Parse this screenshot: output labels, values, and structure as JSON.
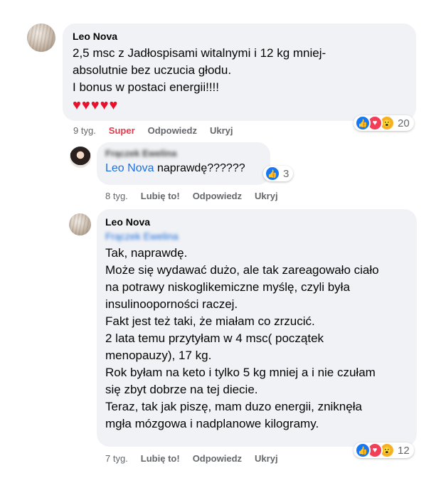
{
  "comment1": {
    "author": "Leo Nova",
    "text": "2,5 msc z Jadłospisami witalnymi i 12 kg mniej-\nabsolutnie bez uczucia głodu.\nI bonus w postaci energii!!!!",
    "hearts": "♥♥♥♥♥",
    "time": "9 tyg.",
    "reaction_label": "Super",
    "reply_label": "Odpowiedz",
    "hide_label": "Ukryj",
    "reaction_count": "20"
  },
  "comment2": {
    "author": "Frączek Ewelina",
    "mention": "Leo Nova",
    "text": " naprawdę??????",
    "time": "8 tyg.",
    "like_label": "Lubię to!",
    "reply_label": "Odpowiedz",
    "hide_label": "Ukryj",
    "reaction_count": "3"
  },
  "comment3": {
    "author": "Leo Nova",
    "mention": "Frączek Ewelina",
    "text": "Tak, naprawdę.\nMoże się wydawać dużo, ale tak zareagowało ciało\nna potrawy niskoglikemiczne myślę, czyli była\ninsulinooporności raczej.\nFakt jest też taki, że miałam co zrzucić.\n2 lata temu przytyłam w 4 msc( początek\nmenopauzy), 17 kg.\nRok byłam na keto i tylko 5 kg mniej a i nie czułam\nsię zbyt dobrze na tej diecie.\nTeraz, tak jak piszę, mam duzo energii, zniknęła\nmgła mózgowa i nadplanowe kilogramy.",
    "time": "7 tyg.",
    "like_label": "Lubię to!",
    "reply_label": "Odpowiedz",
    "hide_label": "Ukryj",
    "reaction_count": "12"
  },
  "colors": {
    "bubble": "#f0f2f5",
    "link": "#216fdb",
    "super": "#e4394b",
    "muted": "#65676b"
  },
  "icons": [
    "like-icon",
    "love-icon",
    "wow-icon"
  ]
}
